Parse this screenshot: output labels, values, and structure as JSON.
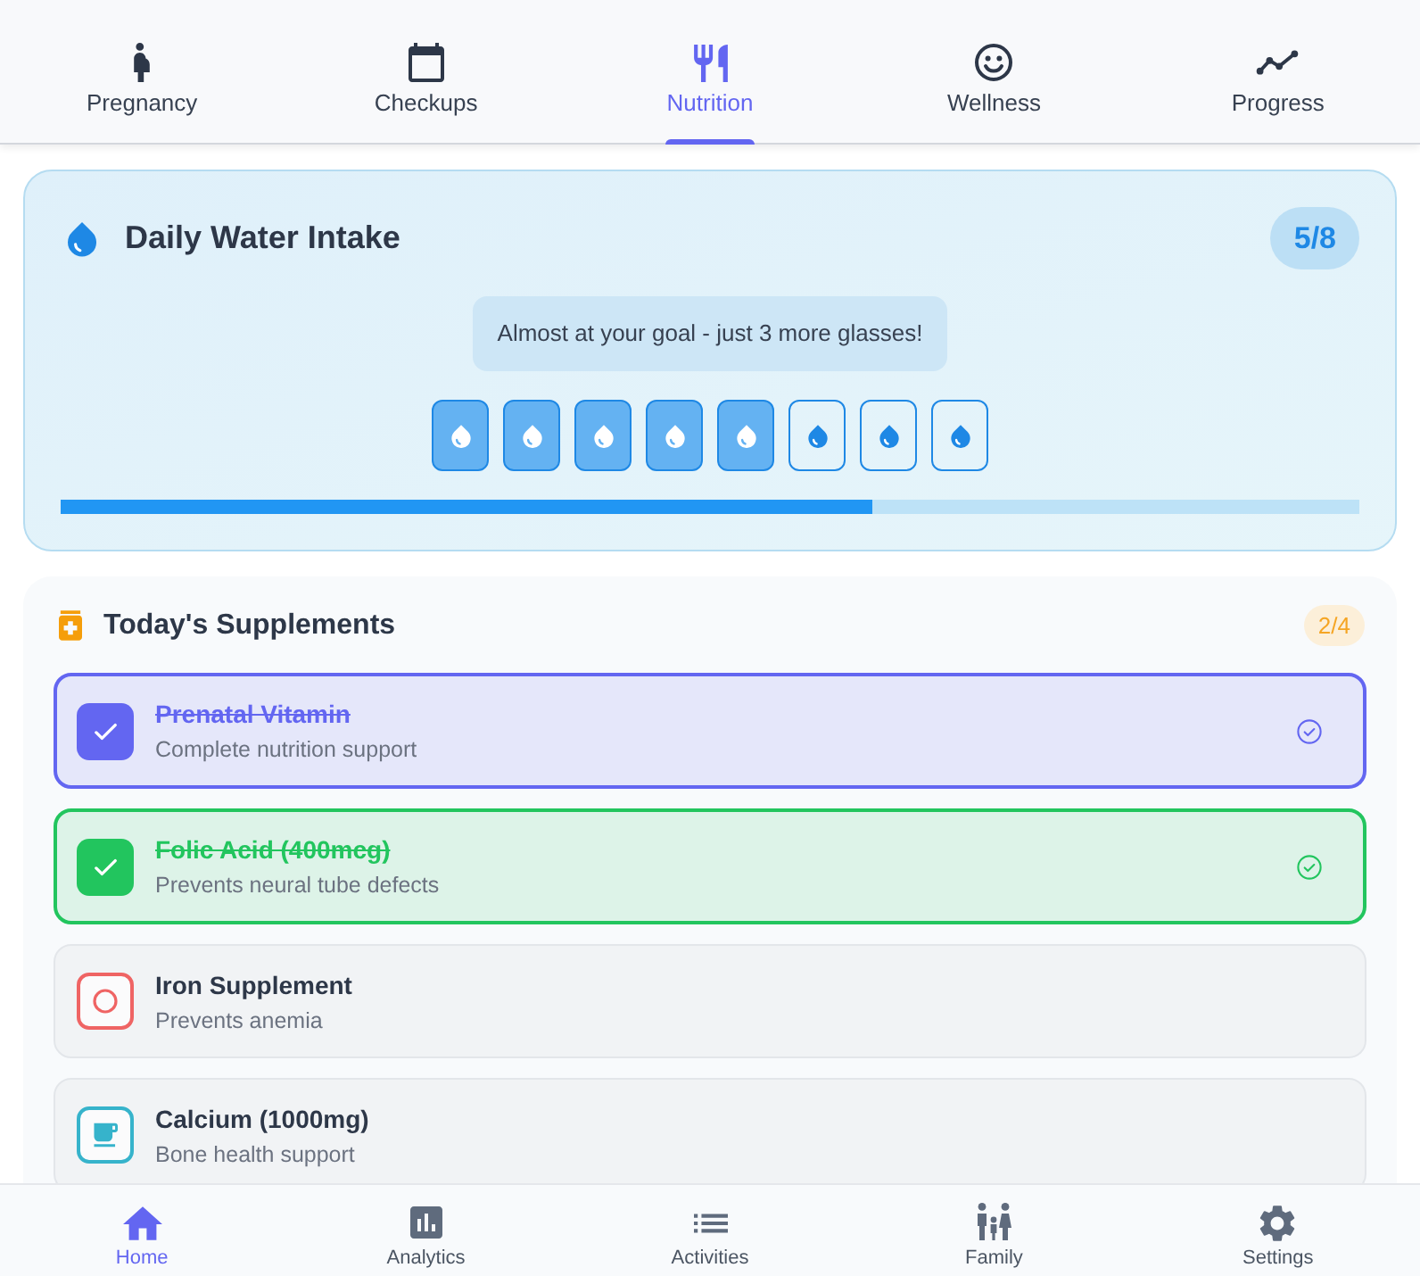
{
  "top_tabs": [
    {
      "label": "Pregnancy",
      "selected": false
    },
    {
      "label": "Checkups",
      "selected": false
    },
    {
      "label": "Nutrition",
      "selected": true
    },
    {
      "label": "Wellness",
      "selected": false
    },
    {
      "label": "Progress",
      "selected": false
    }
  ],
  "water_intake": {
    "title": "Daily Water Intake",
    "count": "5/8",
    "message": "Almost at your goal - just 3 more glasses!",
    "glasses": [
      {
        "filled": true
      },
      {
        "filled": true
      },
      {
        "filled": true
      },
      {
        "filled": true
      },
      {
        "filled": true
      },
      {
        "filled": false
      },
      {
        "filled": false
      },
      {
        "filled": false
      }
    ],
    "level": 0.625
  },
  "supplements": {
    "title": "Today's Supplements",
    "count": "2/4",
    "items": [
      {
        "name": "Prenatal Vitamin",
        "description": "Complete nutrition support",
        "checked": true,
        "color": "#6366f1"
      },
      {
        "name": "Folic Acid (400mcg)",
        "description": "Prevents neural tube defects",
        "checked": true,
        "color": "#22c55e"
      },
      {
        "name": "Iron Supplement",
        "description": "Prevents anemia",
        "checked": false,
        "color": "#ef6464"
      },
      {
        "name": "Calcium (1000mg)",
        "description": "Bone health support",
        "checked": false,
        "color": "#36b3cb"
      }
    ]
  },
  "bottom_nav": [
    {
      "label": "Home",
      "selected": true
    },
    {
      "label": "Analytics",
      "selected": false
    },
    {
      "label": "Activities",
      "selected": false
    },
    {
      "label": "Family",
      "selected": false
    },
    {
      "label": "Settings",
      "selected": false
    }
  ]
}
